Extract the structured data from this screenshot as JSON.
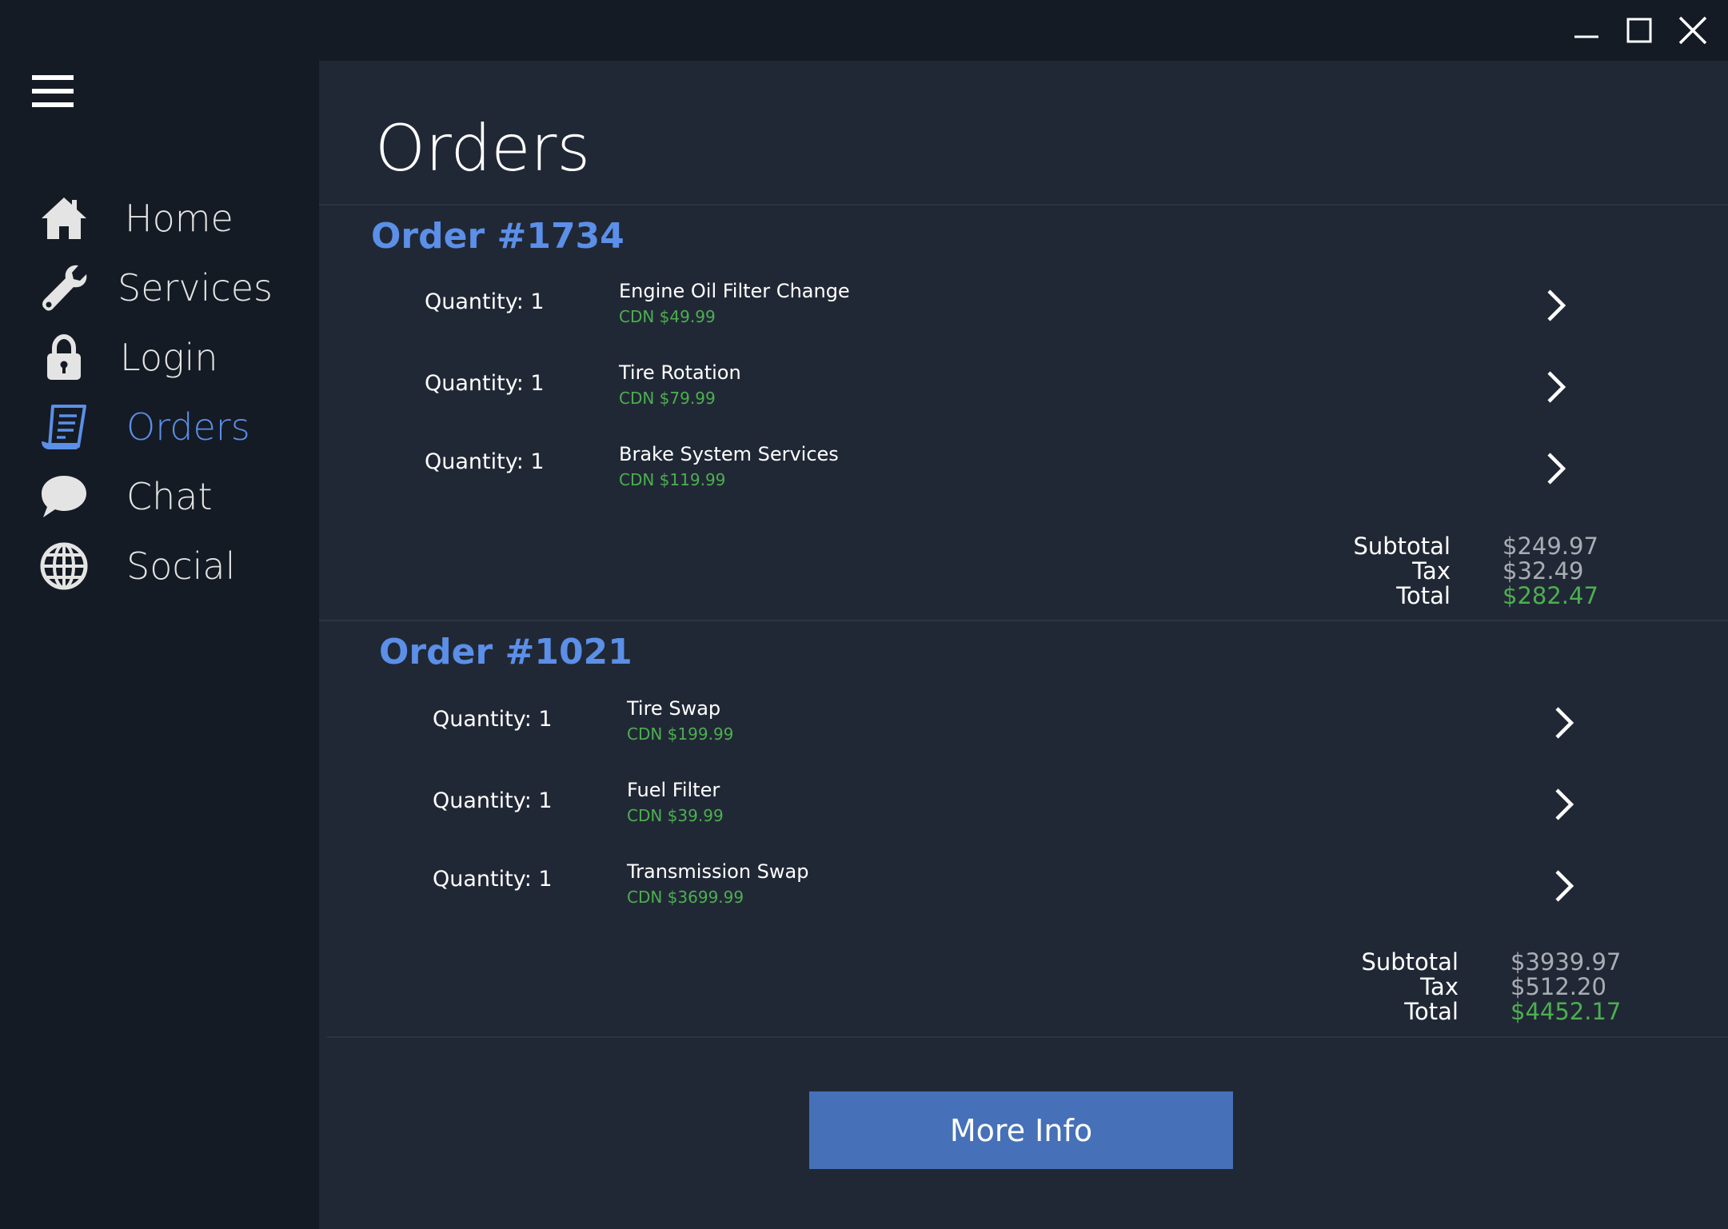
{
  "window": {
    "controls": {
      "minimize": "minimize-icon",
      "maximize": "maximize-icon",
      "close": "close-icon"
    }
  },
  "sidebar": {
    "menu_icon": "hamburger-icon",
    "items": [
      {
        "label": "Home",
        "icon": "home-icon",
        "active": false
      },
      {
        "label": "Services",
        "icon": "wrench-icon",
        "active": false
      },
      {
        "label": "Login",
        "icon": "lock-icon",
        "active": false
      },
      {
        "label": "Orders",
        "icon": "receipt-icon",
        "active": true
      },
      {
        "label": "Chat",
        "icon": "chat-bubble-icon",
        "active": false
      },
      {
        "label": "Social",
        "icon": "globe-icon",
        "active": false
      }
    ]
  },
  "main": {
    "title": "Orders",
    "orders": [
      {
        "title": "Order #1734",
        "items": [
          {
            "quantity": "Quantity: 1",
            "name": "Engine Oil Filter Change",
            "price": "CDN $49.99"
          },
          {
            "quantity": "Quantity: 1",
            "name": "Tire Rotation",
            "price": "CDN $79.99"
          },
          {
            "quantity": "Quantity: 1",
            "name": "Brake System Services",
            "price": "CDN $119.99"
          }
        ],
        "subtotal_label": "Subtotal",
        "subtotal": "$249.97",
        "tax_label": "Tax",
        "tax": "$32.49",
        "total_label": "Total",
        "total": "$282.47"
      },
      {
        "title": "Order #1021",
        "items": [
          {
            "quantity": "Quantity: 1",
            "name": "Tire Swap",
            "price": "CDN $199.99"
          },
          {
            "quantity": "Quantity: 1",
            "name": "Fuel Filter",
            "price": "CDN $39.99"
          },
          {
            "quantity": "Quantity: 1",
            "name": "Transmission Swap",
            "price": "CDN $3699.99"
          }
        ],
        "subtotal_label": "Subtotal",
        "subtotal": "$3939.97",
        "tax_label": "Tax",
        "tax": "$512.20",
        "total_label": "Total",
        "total": "$4452.17"
      }
    ],
    "more_info_label": "More Info"
  },
  "colors": {
    "accent": "#5b8fe8",
    "price_green": "#4caf50",
    "button_blue": "#4671b8",
    "sidebar_bg": "#151b24",
    "content_bg": "#212835"
  }
}
